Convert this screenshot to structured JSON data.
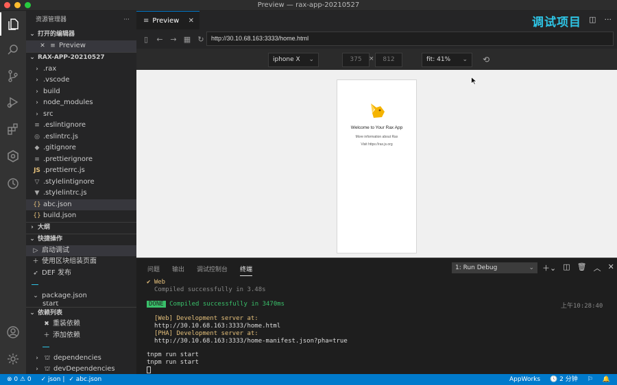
{
  "window": {
    "title": "Preview — rax-app-20210527"
  },
  "explorer": {
    "title": "资源管理器",
    "more": "···",
    "open_editors_label": "打开的编辑器",
    "open_editor_item": "Preview",
    "project_label": "RAX-APP-20210527",
    "files": [
      ".rax",
      ".vscode",
      "build",
      "node_modules",
      "src",
      ".eslintignore",
      ".eslintrc.js",
      ".gitignore",
      ".prettierignore",
      ".prettierrc.js",
      ".stylelintignore",
      ".stylelintrc.js",
      "abc.json",
      "build.json"
    ],
    "outline_label": "大纲",
    "quick_label": "快捷操作",
    "quick_items": [
      "启动调试",
      "使用区块组装页面",
      "DEF 发布"
    ],
    "package_item": "package.json",
    "package_child": "start",
    "deps_label": "依赖列表",
    "deps_actions": [
      "重装依赖",
      "添加依赖"
    ],
    "deps_items": [
      "dependencies",
      "devDependencies"
    ]
  },
  "tabs": {
    "preview_label": "Preview"
  },
  "overlay_label": "调试项目",
  "browser": {
    "url": "http://30.10.68.163:3333/home.html",
    "device": "iphone X",
    "width": "375",
    "height": "812",
    "times": "×",
    "fit": "fit: 41%"
  },
  "phone": {
    "welcome": "Welcome to Your Rax App",
    "more": "More information about Rax",
    "visit": "Visit https://rax.js.org"
  },
  "panel": {
    "tabs": [
      "问题",
      "输出",
      "调试控制台",
      "终端"
    ],
    "terminal_select": "1: Run Debug",
    "lines": {
      "web_check": "✔ Web",
      "compiled1": "Compiled successfully in 3.48s",
      "done": "DONE",
      "compiled2": "Compiled successfully in 3470ms",
      "time": "上午10:28:40",
      "web_server": "[Web] Development server at:",
      "web_url": "http://30.10.68.163:3333/home.html",
      "pha_server": "[PHA] Development server at:",
      "pha_url": "http://30.10.68.163:3333/home-manifest.json?pha=true",
      "cmd1": "tnpm run start",
      "cmd2": "tnpm run start"
    }
  },
  "statusbar": {
    "errors": "⊗ 0 ⚠ 0",
    "json": "✓ json |",
    "abc": "✓ abc.json",
    "appworks": "AppWorks",
    "time": "🕓 2 分钟",
    "bell": "🔔"
  },
  "colors": {
    "accent": "#007acc",
    "overlay": "#2ec5e6",
    "done_bg": "#39c06a",
    "yellow": "#e5c07b"
  }
}
